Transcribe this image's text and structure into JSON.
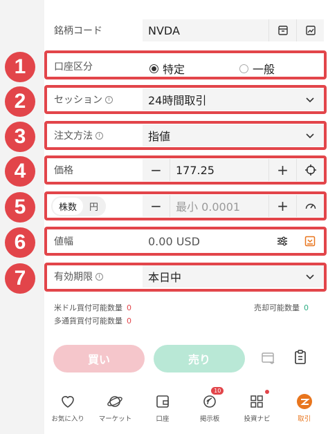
{
  "form": {
    "ticker": {
      "label": "銘柄コード",
      "value": "NVDA"
    },
    "account": {
      "label": "口座区分",
      "options": [
        "特定",
        "一般"
      ],
      "selected": "特定"
    },
    "session": {
      "label": "セッション",
      "value": "24時間取引"
    },
    "order_method": {
      "label": "注文方法",
      "value": "指値"
    },
    "price": {
      "label": "価格",
      "value": "177.25"
    },
    "quantity": {
      "unit_shares": "株数",
      "unit_yen": "円",
      "placeholder": "最小 0.0001"
    },
    "price_range": {
      "label": "値幅",
      "value": "0.00 USD"
    },
    "expiry": {
      "label": "有効期限",
      "value": "本日中"
    }
  },
  "badges": [
    "1",
    "2",
    "3",
    "4",
    "5",
    "6",
    "7"
  ],
  "quantities": {
    "usd_buy_label": "米ドル買付可能数量",
    "usd_buy_value": "0",
    "multi_buy_label": "多通貨買付可能数量",
    "multi_buy_value": "0",
    "sell_label": "売却可能数量",
    "sell_value": "0"
  },
  "actions": {
    "buy": "買い",
    "sell": "売り"
  },
  "nav": [
    {
      "label": "お気に入り",
      "icon": "heart-icon"
    },
    {
      "label": "マーケット",
      "icon": "planet-icon"
    },
    {
      "label": "口座",
      "icon": "wallet-icon"
    },
    {
      "label": "掲示板",
      "icon": "board-icon",
      "badge": "10"
    },
    {
      "label": "投資ナビ",
      "icon": "grid-icon"
    },
    {
      "label": "取引",
      "icon": "trade-icon",
      "active": true
    }
  ],
  "colors": {
    "accent_red": "#e2454a",
    "accent_orange": "#e8751d",
    "buy": "#f5c6cb",
    "sell": "#b9e8d6"
  }
}
